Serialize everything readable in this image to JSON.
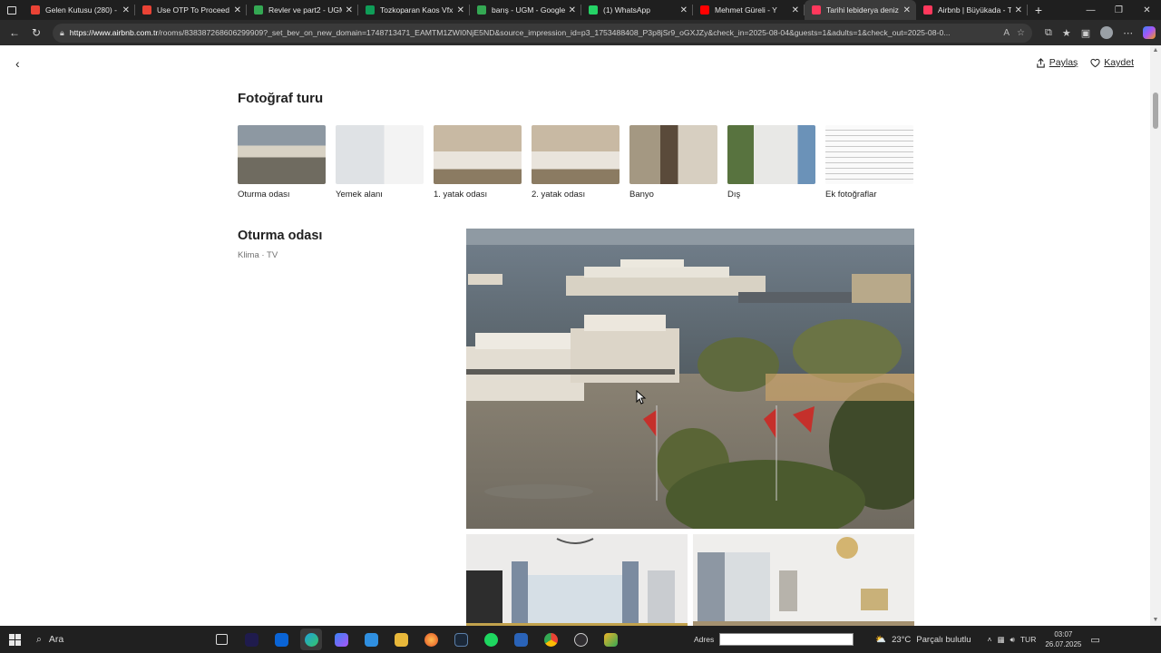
{
  "browser": {
    "tabs": [
      {
        "title": "Gelen Kutusu (280) - b",
        "favicon_color": "#ea4335",
        "active": false
      },
      {
        "title": "Use OTP To Proceed - I",
        "favicon_color": "#ea4335",
        "active": false
      },
      {
        "title": "Revler ve part2 - UGM",
        "favicon_color": "#34a853",
        "active": false
      },
      {
        "title": "Tozkoparan Kaos Vfx Sl",
        "favicon_color": "#0f9d58",
        "active": false
      },
      {
        "title": "barış - UGM - Google D",
        "favicon_color": "#34a853",
        "active": false
      },
      {
        "title": "(1) WhatsApp",
        "favicon_color": "#25d366",
        "active": false
      },
      {
        "title": "Mehmet Güreli - Y",
        "favicon_color": "#ff0000",
        "active": false
      },
      {
        "title": "Tarihi lebiderya deniz m",
        "favicon_color": "#ff385c",
        "active": true
      },
      {
        "title": "Airbnb | Büyükada - Ta",
        "favicon_color": "#ff385c",
        "active": false
      }
    ],
    "url_host": "https://www.airbnb.com.tr",
    "url_rest": "/rooms/838387268606299909?_set_bev_on_new_domain=1748713471_EAMTM1ZWI0NjE5ND&source_impression_id=p3_1753488408_P3p8jSr9_oGXJZy&check_in=2025-08-04&guests=1&adults=1&check_out=2025-08-0..."
  },
  "page": {
    "share_label": "Paylaş",
    "save_label": "Kaydet",
    "tour_title": "Fotoğraf turu",
    "thumbnails": [
      {
        "label": "Oturma odası",
        "icon": "harbor-photo"
      },
      {
        "label": "Yemek alanı",
        "icon": "kitchen-photo"
      },
      {
        "label": "1. yatak odası",
        "icon": "bedroom-photo"
      },
      {
        "label": "2. yatak odası",
        "icon": "bedroom-photo"
      },
      {
        "label": "Banyo",
        "icon": "bathroom-photo"
      },
      {
        "label": "Dış",
        "icon": "exterior-photo"
      },
      {
        "label": "Ek fotoğraflar",
        "icon": "text-photo"
      }
    ],
    "room_title": "Oturma odası",
    "room_amenities": "Klima · TV"
  },
  "taskbar": {
    "search_label": "Ara",
    "address_label": "Adres",
    "temperature": "23°C",
    "weather_text": "Parçalı bulutlu",
    "lang": "TUR",
    "time": "03:07",
    "date": "26.07.2025"
  }
}
